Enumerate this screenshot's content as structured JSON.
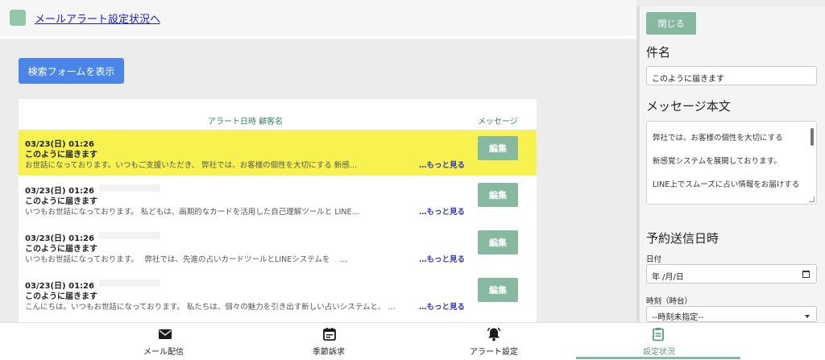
{
  "header": {
    "link": "メールアラート設定状況へ"
  },
  "search_button": "検索フォームを表示",
  "table": {
    "col_date_customer": "アラート日時 顧客名",
    "col_message": "メッセージ",
    "more_label": "…もっと見る",
    "edit_label": "編集",
    "rows": [
      {
        "date": "03/23(日) 01:26",
        "subject": "このように届きます",
        "body": "お世話になっております。いつもご支援いただき、 弊社では、お客様の個性を大切にする 新感…",
        "highlighted": true
      },
      {
        "date": "03/23(日) 01:26",
        "subject": "このように届きます",
        "body": "いつもお世話になっております。 私どもは、画期的なカードを活用した自己理解ツールと LINE…",
        "highlighted": false
      },
      {
        "date": "03/23(日) 01:26",
        "subject": "このように届きます",
        "body": "いつもお世話になっております。　 弊社では、先進の占いカードツールとLINEシステムを　 …",
        "highlighted": false
      },
      {
        "date": "03/23(日) 01:26",
        "subject": "このように届きます",
        "body": "こんにちは。いつもお世話になっております。 私たちは、個々の魅力を引き出す新しい占いシステムと、 …",
        "highlighted": false
      }
    ]
  },
  "drawer": {
    "close_label": "閉じる",
    "subject_heading": "件名",
    "subject_value": "このように届きます",
    "body_heading": "メッセージ本文",
    "body_lines": [
      "弊社では、お客様の個性を大切にする",
      "新感覚システムを展開しております。",
      "LINE上でスムーズに占い情報をお届けする"
    ],
    "schedule_heading": "予約送信日時",
    "date_label": "日付",
    "date_placeholder": "年 /月/日",
    "time_label": "時刻（時台）",
    "time_value": "--時刻未指定--"
  },
  "nav": {
    "items": [
      {
        "label": "メール配信",
        "icon": "envelope-icon"
      },
      {
        "label": "季節訴求",
        "icon": "calendar-icon"
      },
      {
        "label": "アラート設定",
        "icon": "bell-icon"
      },
      {
        "label": "設定状況",
        "icon": "clipboard-icon"
      }
    ],
    "active_index": 3,
    "accent": "#86b9a0"
  },
  "colors": {
    "primary_button": "#4a86e8",
    "green_button": "#86b9a0",
    "highlight_row": "#f7f24f",
    "link": "#1b1bd0"
  }
}
